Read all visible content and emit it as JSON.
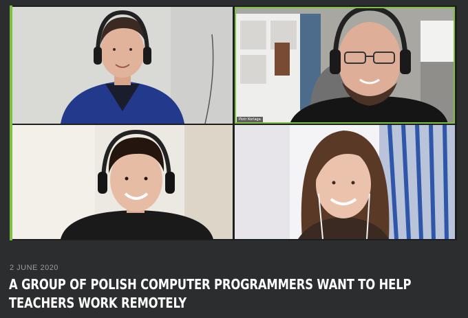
{
  "article": {
    "date": "2 JUNE 2020",
    "title": "A GROUP OF POLISH COMPUTER PROGRAMMERS WANT TO HELP TEACHERS WORK REMOTELY"
  },
  "video_call": {
    "participants": [
      {
        "name": ""
      },
      {
        "name": "Piotr Korlaga"
      },
      {
        "name": ""
      },
      {
        "name": ""
      }
    ]
  },
  "colors": {
    "background": "#2b2d2f",
    "accent": "#7dc043",
    "date_text": "#9a9c9e",
    "title_text": "#ffffff"
  }
}
